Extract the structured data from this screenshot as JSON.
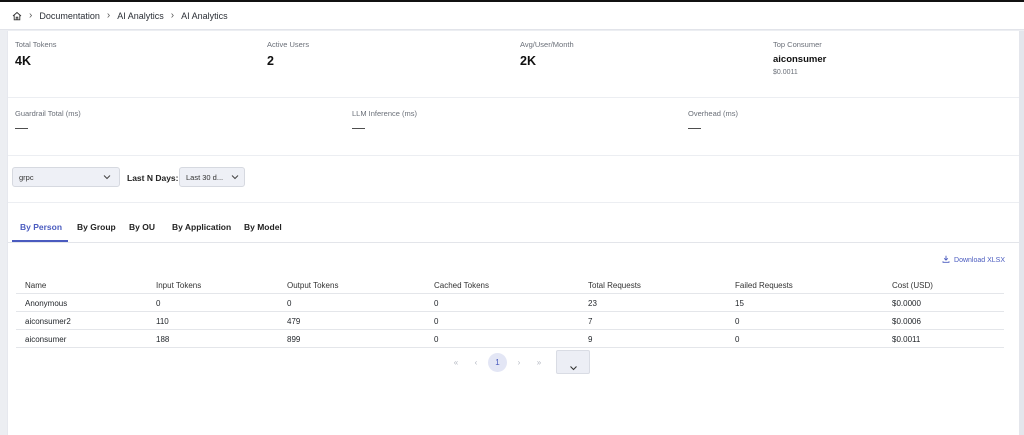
{
  "breadcrumb": {
    "items": [
      "Documentation",
      "AI Analytics",
      "AI Analytics"
    ]
  },
  "stats_top": [
    {
      "label": "Total Tokens",
      "value": "4K"
    },
    {
      "label": "Active Users",
      "value": "2"
    },
    {
      "label": "Avg/User/Month",
      "value": "2K"
    },
    {
      "label": "Top Consumer",
      "value": "aiconsumer",
      "sub": "$0.0011"
    }
  ],
  "stats_latency": [
    {
      "label": "Guardrail Total (ms)",
      "value": "—"
    },
    {
      "label": "LLM Inference (ms)",
      "value": "—"
    },
    {
      "label": "Overhead (ms)",
      "value": "—"
    }
  ],
  "filters": {
    "protocol_value": "grpc",
    "days_label": "Last N Days:",
    "days_value": "Last 30 d..."
  },
  "tabs": [
    "By Person",
    "By Group",
    "By OU",
    "By Application",
    "By Model"
  ],
  "active_tab": "By Person",
  "download_label": "Download XLSX",
  "table": {
    "columns": [
      "Name",
      "Input Tokens",
      "Output Tokens",
      "Cached Tokens",
      "Total Requests",
      "Failed Requests",
      "Cost (USD)"
    ],
    "rows": [
      [
        "Anonymous",
        "0",
        "0",
        "0",
        "23",
        "15",
        "$0.0000"
      ],
      [
        "aiconsumer2",
        "110",
        "479",
        "0",
        "7",
        "0",
        "$0.0006"
      ],
      [
        "aiconsumer",
        "188",
        "899",
        "0",
        "9",
        "0",
        "$0.0011"
      ]
    ]
  },
  "pagination": {
    "first": "«",
    "prev": "‹",
    "current": "1",
    "next": "›",
    "last": "»"
  },
  "colors": {
    "accent": "#4a5bbf",
    "background": "#eceef2"
  }
}
